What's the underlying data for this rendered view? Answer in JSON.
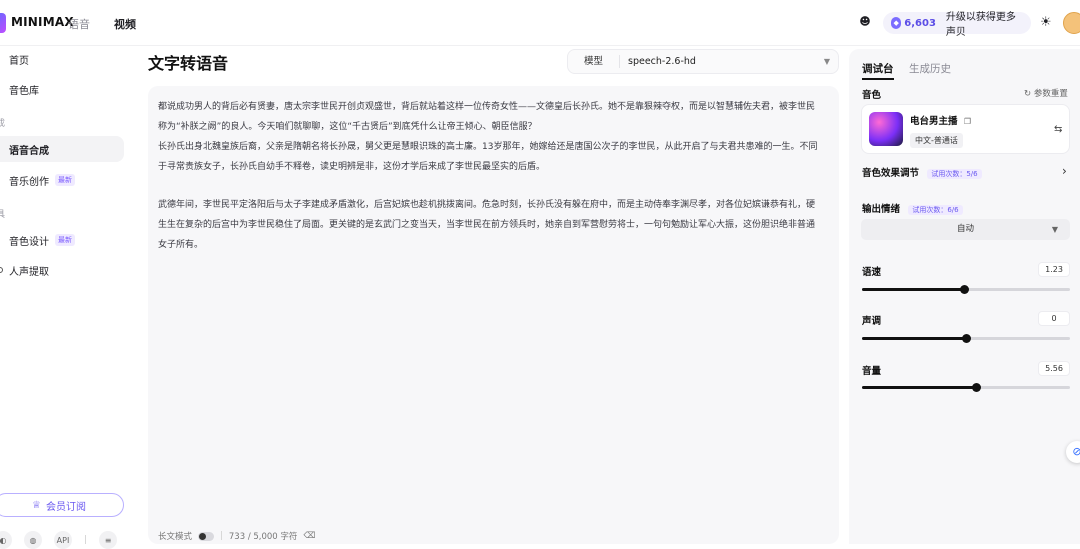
{
  "header": {
    "logo_text": "MINIMAX",
    "nav_voice": "语音",
    "nav_video": "视频",
    "credits": "6,603",
    "upgrade_text": "升级以获得更多声贝"
  },
  "sidebar": {
    "items": [
      {
        "label": "首页"
      },
      {
        "label": "音色库"
      },
      {
        "label": "语音合成"
      },
      {
        "label": "音乐创作",
        "badge": "最新"
      },
      {
        "label": "音色设计",
        "badge": "最新"
      },
      {
        "label": "人声提取"
      }
    ],
    "group1": "成",
    "group2": "具",
    "member_label": "会员订阅",
    "api_label": "API"
  },
  "main": {
    "title": "文字转语音",
    "model_label": "模型",
    "model_value": "speech-2.6-hd",
    "paragraphs": [
      "都说成功男人的背后必有贤妻，唐太宗李世民开创贞观盛世，背后就站着这样一位传奇女性——文德皇后长孙氏。她不是靠狠辣夺权，而是以智慧辅佐夫君，被李世民称为“补朕之阙”的良人。今天咱们就聊聊，这位“千古贤后”到底凭什么让帝王倾心、朝臣信服？",
      "长孙氏出身北魏皇族后裔，父亲是隋朝名将长孙晟，舅父更是慧眼识珠的高士廉。13岁那年，她嫁给还是唐国公次子的李世民，从此开启了与夫君共患难的一生。不同于寻常贵族女子，长孙氏自幼手不释卷，读史明辨是非，这份才学后来成了李世民最坚实的后盾。",
      "武德年间，李世民平定洛阳后与太子李建成矛盾激化，后宫妃嫔也趁机挑拨离间。危急时刻，长孙氏没有躲在府中，而是主动侍奉李渊尽孝，对各位妃嫔谦恭有礼，硬生生在复杂的后宫中为李世民稳住了局面。更关键的是玄武门之变当天，当李世民在前方领兵时，她亲自到军营慰劳将士，一句句勉励让军心大振，这份胆识绝非普通女子所有。"
    ],
    "long_mode_label": "长文模式",
    "char_count": "733 / 5,000 字符"
  },
  "panel": {
    "tab_active": "调试台",
    "tab_inactive": "生成历史",
    "voice_label": "音色",
    "reset_label": "参数重置",
    "voice_name": "电台男主播",
    "voice_tag": "中文-普通话",
    "effect_label": "音色效果调节",
    "effect_trial": "试用次数：5/6",
    "emotion_label": "输出情绪",
    "emotion_trial": "试用次数：6/6",
    "emotion_value": "自动",
    "sliders": [
      {
        "label": "语速",
        "value": "1.23",
        "fraction": 0.49
      },
      {
        "label": "声调",
        "value": "0",
        "fraction": 0.5
      },
      {
        "label": "音量",
        "value": "5.56",
        "fraction": 0.55
      }
    ]
  }
}
